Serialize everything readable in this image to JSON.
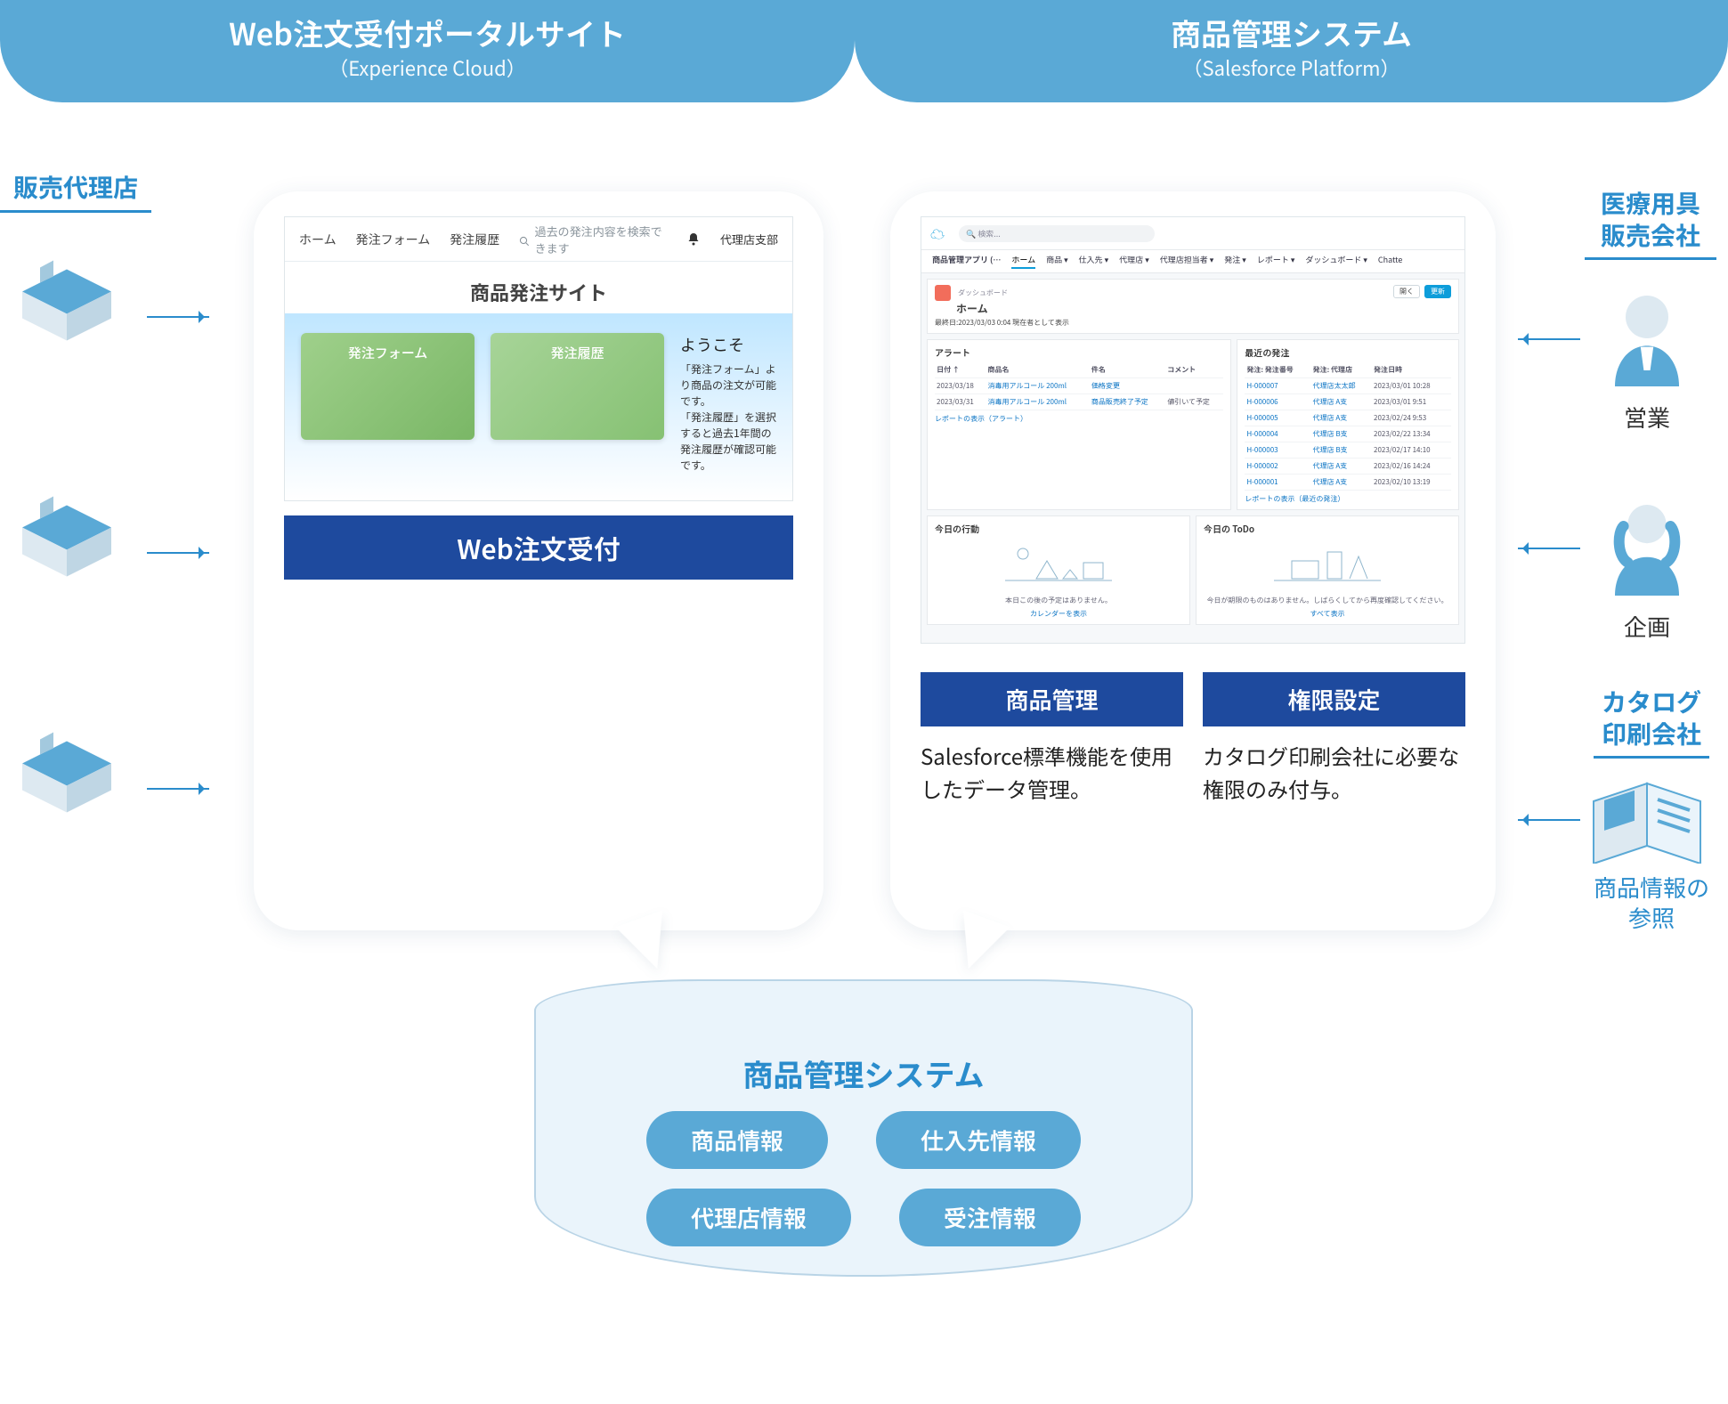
{
  "headers": {
    "left": {
      "title": "Web注文受付ポータルサイト",
      "sub": "（Experience Cloud）"
    },
    "right": {
      "title": "商品管理システム",
      "sub": "（Salesforce Platform）"
    }
  },
  "leftBubble": {
    "band": "Web注文受付",
    "portal": {
      "nav": [
        "ホーム",
        "発注フォーム",
        "発注履歴"
      ],
      "searchIcon": "🔍",
      "searchPlaceholder": "過去の発注内容を検索できます",
      "bell": "🔔",
      "user": "代理店支部",
      "title": "商品発注サイト",
      "card1": "発注フォーム",
      "card2": "発注履歴",
      "welcomeH": "ようこそ",
      "welcomeT": "「発注フォーム」より商品の注文が可能です。\n「発注履歴」を選択すると過去1年間の発注履歴が確認可能です。"
    }
  },
  "rightBubble": {
    "col1": {
      "band": "商品管理",
      "desc": "Salesforce標準機能を使用したデータ管理。"
    },
    "col2": {
      "band": "権限設定",
      "desc": "カタログ印刷会社に必要な権限のみ付与。"
    },
    "sf": {
      "searchPlaceholder": "検索...",
      "appName": "商品管理アプリ (…",
      "tabs": [
        "ホーム",
        "商品 ▾",
        "仕入先 ▾",
        "代理店 ▾",
        "代理店担当者 ▾",
        "発注 ▾",
        "レポート ▾",
        "ダッシュボード ▾",
        "Chatte"
      ],
      "dashLabel": "ダッシュボード",
      "dashTitle": "ホーム",
      "dashMeta": "最終日:2023/03/03 0:04 現在者として表示",
      "btnOpen": "開く",
      "btnRefresh": "更新",
      "alertTitle": "アラート",
      "alertCols": [
        "日付 ↑",
        "商品名",
        "件名",
        "コメント"
      ],
      "alertRows": [
        {
          "d": "2023/03/18",
          "p": "消毒用アルコール 200ml",
          "s": "価格変更",
          "c": ""
        },
        {
          "d": "2023/03/31",
          "p": "消毒用アルコール 200ml",
          "s": "商品販売終了予定",
          "c": "値引いて予定"
        }
      ],
      "alertFoot": "レポートの表示（アラート）",
      "recentTitle": "最近の発注",
      "recentCols": [
        "発注: 発注番号",
        "発注: 代理店",
        "発注日時"
      ],
      "recentRows": [
        {
          "n": "H-000007",
          "a": "代理店太太郎",
          "t": "2023/03/01 10:28"
        },
        {
          "n": "H-000006",
          "a": "代理店 A支",
          "t": "2023/03/01 9:51"
        },
        {
          "n": "H-000005",
          "a": "代理店 A支",
          "t": "2023/02/24 9:53"
        },
        {
          "n": "H-000004",
          "a": "代理店 B支",
          "t": "2023/02/22 13:34"
        },
        {
          "n": "H-000003",
          "a": "代理店 B支",
          "t": "2023/02/17 14:10"
        },
        {
          "n": "H-000002",
          "a": "代理店 A支",
          "t": "2023/02/16 14:24"
        },
        {
          "n": "H-000001",
          "a": "代理店 A支",
          "t": "2023/02/10 13:19"
        }
      ],
      "recentFoot": "レポートの表示（最近の発注）",
      "eventsTitle": "今日の行動",
      "eventsEmpty": "本日この後の予定はありません。",
      "eventsLink": "カレンダーを表示",
      "todoTitle": "今日の ToDo",
      "todoEmpty": "今日が期限のものはありません。しばらくしてから再度確認してください。",
      "todoLink": "すべて表示"
    }
  },
  "db": {
    "title": "商品管理システム",
    "chips": [
      "商品情報",
      "仕入先情報",
      "代理店情報",
      "受注情報"
    ]
  },
  "left": {
    "label": "販売代理店"
  },
  "right": {
    "label1": "医療用具\n販売会社",
    "sub1": "営業",
    "sub2": "企画",
    "label2": "カタログ\n印刷会社",
    "sub3": "商品情報の\n参照"
  }
}
